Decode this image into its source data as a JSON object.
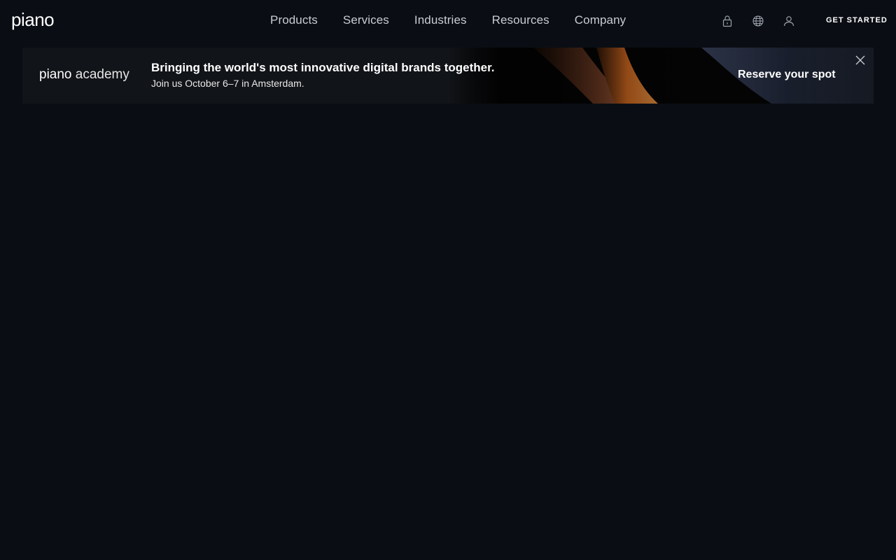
{
  "header": {
    "logo": "piano",
    "nav": [
      "Products",
      "Services",
      "Industries",
      "Resources",
      "Company"
    ],
    "icons": [
      "lock-icon",
      "globe-icon",
      "user-icon"
    ],
    "cta_label": "GET STARTED"
  },
  "banner": {
    "logo_brand": "piano",
    "logo_suffix": "academy",
    "headline": "Bringing the world's most innovative digital brands together.",
    "subtext": "Join us October 6–7 in Amsterdam.",
    "cta_label": "Reserve your spot",
    "close_icon": "close-icon"
  },
  "colors": {
    "background": "#0a0e14",
    "banner_background": "#111418",
    "accent_orange": "#f27a25",
    "nav_text": "#c9ccd1"
  }
}
